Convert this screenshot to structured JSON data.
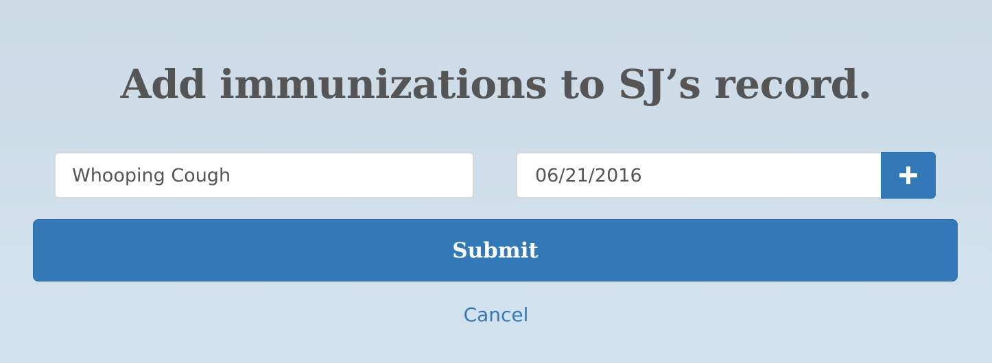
{
  "header": {
    "title": "Add immunizations to SJ’s record."
  },
  "form": {
    "vaccine_value": "Whooping Cough",
    "date_value": "06/21/2016",
    "add_icon": "plus-icon",
    "submit_label": "Submit",
    "cancel_label": "Cancel"
  },
  "colors": {
    "accent": "#3479b7",
    "title_text": "#555555",
    "background": "#cfdee9"
  }
}
